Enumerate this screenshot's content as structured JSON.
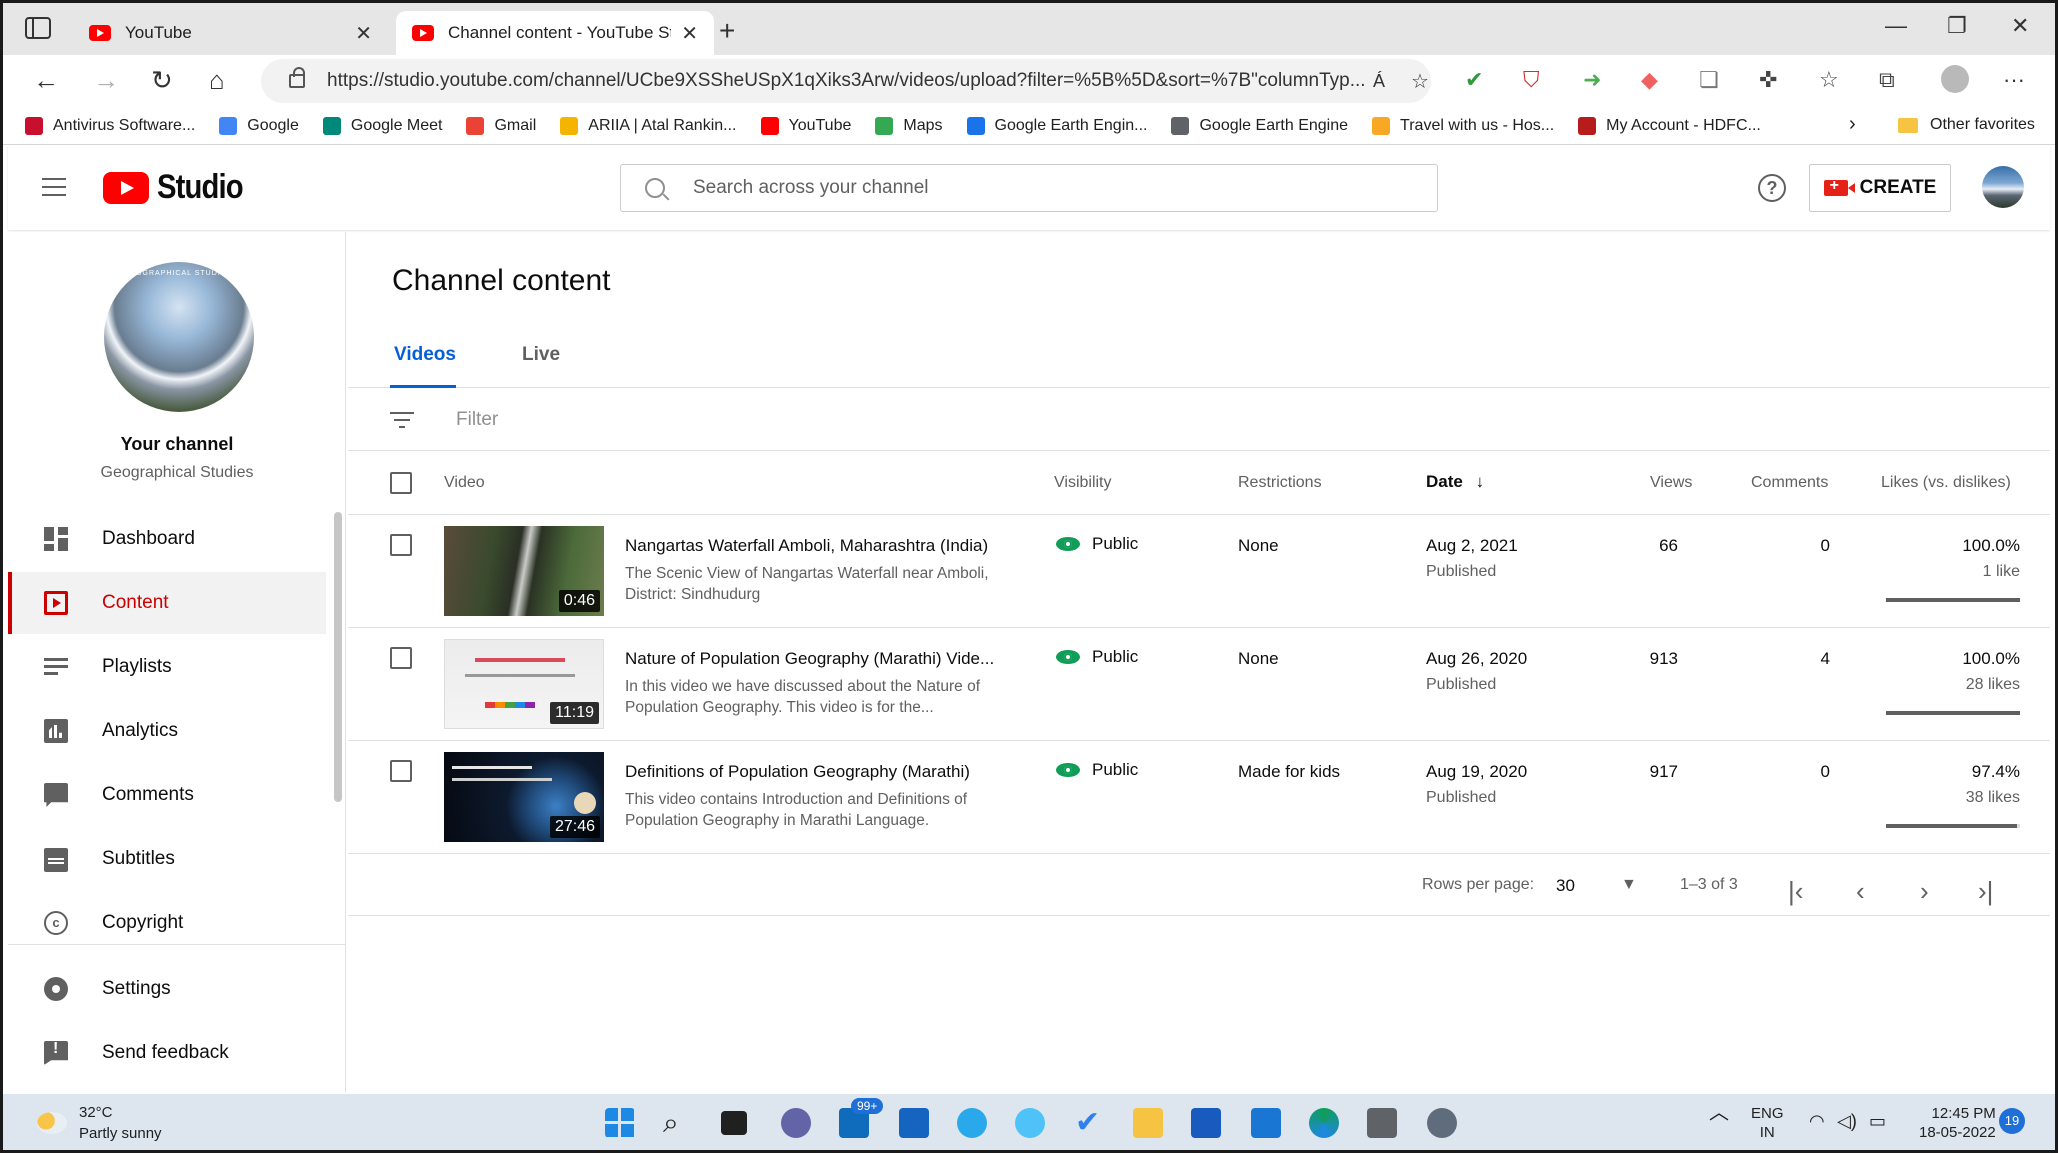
{
  "browser": {
    "tabs": [
      {
        "title": "YouTube",
        "active": false
      },
      {
        "title": "Channel content - YouTube Studio",
        "active": true
      }
    ],
    "url": "https://studio.youtube.com/channel/UCbe9XSSheUSpX1qXiks3Arw/videos/upload?filter=%5B%5D&sort=%7B\"columnTyp...",
    "read_aloud": "Á",
    "favorites": [
      {
        "label": "Antivirus Software...",
        "color": "#c8102e"
      },
      {
        "label": "Google",
        "color": "#4285f4"
      },
      {
        "label": "Google Meet",
        "color": "#00897b"
      },
      {
        "label": "Gmail",
        "color": "#ea4335"
      },
      {
        "label": "ARIIA | Atal Rankin...",
        "color": "#f4b400"
      },
      {
        "label": "YouTube",
        "color": "#ff0000"
      },
      {
        "label": "Maps",
        "color": "#34a853"
      },
      {
        "label": "Google Earth Engin...",
        "color": "#1a73e8"
      },
      {
        "label": "Google Earth Engine",
        "color": "#5f6368"
      },
      {
        "label": "Travel with us - Hos...",
        "color": "#f9a825"
      },
      {
        "label": "My Account - HDFC...",
        "color": "#b71c1c"
      }
    ],
    "other_favorites": "Other favorites"
  },
  "header": {
    "logo_text": "Studio",
    "search_placeholder": "Search across your channel",
    "create_label": "CREATE"
  },
  "sidebar": {
    "your_channel": "Your channel",
    "channel_name": "Geographical Studies",
    "items": [
      {
        "label": "Dashboard",
        "icon": "dashboard-icon"
      },
      {
        "label": "Content",
        "icon": "content-icon",
        "active": true
      },
      {
        "label": "Playlists",
        "icon": "playlists-icon"
      },
      {
        "label": "Analytics",
        "icon": "analytics-icon"
      },
      {
        "label": "Comments",
        "icon": "comments-icon"
      },
      {
        "label": "Subtitles",
        "icon": "subtitles-icon"
      },
      {
        "label": "Copyright",
        "icon": "copyright-icon"
      },
      {
        "label": "Settings",
        "icon": "settings-icon"
      },
      {
        "label": "Send feedback",
        "icon": "feedback-icon"
      }
    ]
  },
  "main": {
    "title": "Channel content",
    "tabs": [
      "Videos",
      "Live"
    ],
    "filter_placeholder": "Filter",
    "columns": {
      "video": "Video",
      "visibility": "Visibility",
      "restrictions": "Restrictions",
      "date": "Date",
      "views": "Views",
      "comments": "Comments",
      "likes": "Likes (vs. dislikes)"
    },
    "rows": [
      {
        "title": "Nangartas Waterfall Amboli, Maharashtra (India)",
        "description": "The Scenic View of Nangartas Waterfall near Amboli, District: Sindhudurg",
        "duration": "0:46",
        "visibility": "Public",
        "restrictions": "None",
        "date": "Aug 2, 2021",
        "date_status": "Published",
        "views": "66",
        "comments": "0",
        "likes_pct": "100.0%",
        "likes_count": "1 like",
        "likes_ratio": 1.0
      },
      {
        "title": "Nature of Population Geography (Marathi) Vide...",
        "description": "In this video we have discussed about the Nature of Population Geography. This video is for the...",
        "duration": "11:19",
        "visibility": "Public",
        "restrictions": "None",
        "date": "Aug 26, 2020",
        "date_status": "Published",
        "views": "913",
        "comments": "4",
        "likes_pct": "100.0%",
        "likes_count": "28 likes",
        "likes_ratio": 1.0
      },
      {
        "title": "Definitions of Population Geography (Marathi)",
        "description": "This video contains Introduction and Definitions of Population Geography in Marathi Language.",
        "duration": "27:46",
        "visibility": "Public",
        "restrictions": "Made for kids",
        "date": "Aug 19, 2020",
        "date_status": "Published",
        "views": "917",
        "comments": "0",
        "likes_pct": "97.4%",
        "likes_count": "38 likes",
        "likes_ratio": 0.974
      }
    ],
    "pagination": {
      "rows_per_page_label": "Rows per page:",
      "rows_per_page": "30",
      "range": "1–3 of 3"
    }
  },
  "taskbar": {
    "temperature": "32°C",
    "weather": "Partly sunny",
    "mail_badge": "99+",
    "language": "ENG",
    "region": "IN",
    "time": "12:45 PM",
    "date": "18-05-2022",
    "notifications": "19"
  }
}
